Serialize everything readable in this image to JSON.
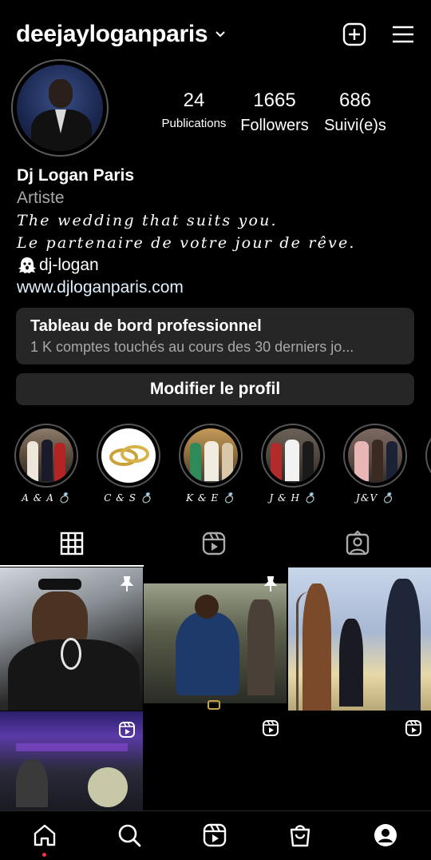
{
  "header": {
    "username": "deejayloganparis"
  },
  "stats": {
    "publications": {
      "value": "24",
      "label": "Publications"
    },
    "followers": {
      "value": "1665",
      "label": "Followers"
    },
    "following": {
      "value": "686",
      "label": "Suivi(e)s"
    }
  },
  "bio": {
    "name": "Dj Logan Paris",
    "category": "Artiste",
    "line1": "The wedding that suits you.",
    "line2": "Le partenaire de votre jour de rêve.",
    "handle": "dj-logan",
    "link": "www.djloganparis.com"
  },
  "pro_dashboard": {
    "title": "Tableau de bord professionnel",
    "subtitle": "1 K comptes touchés au cours des 30 derniers jo..."
  },
  "edit_profile_label": "Modifier le profil",
  "highlights": [
    {
      "label": "A & A 💍"
    },
    {
      "label": "C & S 💍"
    },
    {
      "label": "K & E 💍"
    },
    {
      "label": "J & H 💍"
    },
    {
      "label": "J&V 💍"
    }
  ],
  "tabs": [
    "grid-icon",
    "reels-icon",
    "tagged-icon"
  ],
  "nav": [
    "home-icon",
    "search-icon",
    "reels-icon",
    "shop-icon",
    "profile-icon"
  ],
  "colors": {
    "background": "#000000",
    "button": "#262626",
    "secondary_text": "#a8a8a8",
    "link": "#e0f1ff",
    "notification": "#ff3040"
  }
}
